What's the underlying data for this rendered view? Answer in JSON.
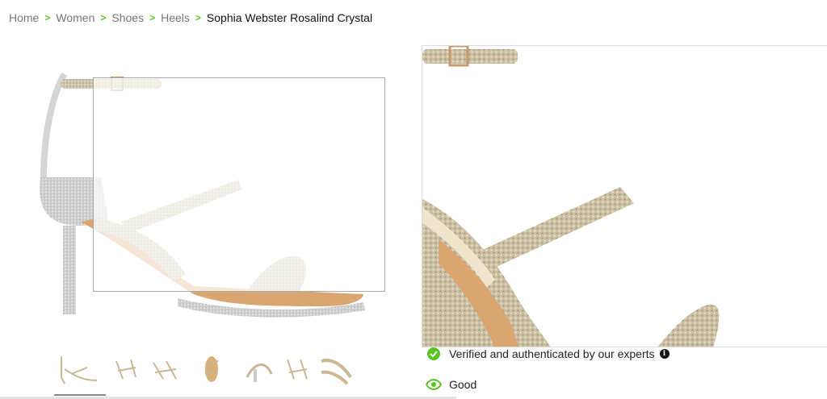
{
  "breadcrumb": {
    "items": [
      "Home",
      "Women",
      "Shoes",
      "Heels"
    ],
    "current": "Sophia Webster Rosalind Crystal"
  },
  "product": {
    "main_image": "glitter-sandal-side-view",
    "thumbnails": [
      "side-view",
      "pair-front",
      "pair-angled",
      "sole-top",
      "heel-detail",
      "pair-back",
      "closeup-strap"
    ]
  },
  "features": [
    {
      "icon": "check-circle-icon",
      "text": "Verified and authenticated by our experts",
      "has_info": true
    },
    {
      "icon": "eye-icon",
      "text": "Good",
      "has_info": false
    }
  ],
  "colors": {
    "accent": "#58c322",
    "glitter": "#cfc3a8",
    "strap_gold": "#d8c7a2",
    "sole_tan": "#d9a672"
  }
}
